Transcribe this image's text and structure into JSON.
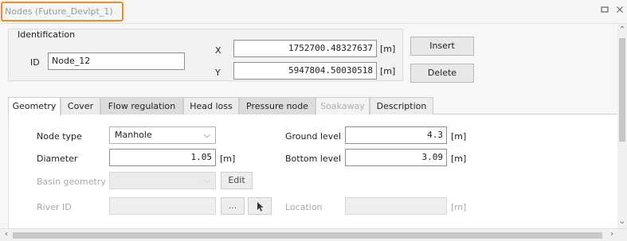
{
  "window": {
    "title": "Nodes (Future_Devlpt_1)",
    "maximize_icon": "maximize-icon",
    "close_icon": "close-icon",
    "accent_color": "#f08a24"
  },
  "identification": {
    "title": "Identification",
    "id_label": "ID",
    "id_value": "Node_12",
    "x_label": "X",
    "x_value": "1752700.48327637",
    "x_unit": "[m]",
    "y_label": "Y",
    "y_value": "5947804.50030518",
    "y_unit": "[m]",
    "insert_label": "Insert",
    "delete_label": "Delete"
  },
  "tabs": [
    {
      "label": "Geometry",
      "state": "active"
    },
    {
      "label": "Cover",
      "state": "normal"
    },
    {
      "label": "Flow regulation",
      "state": "normal"
    },
    {
      "label": "Head loss",
      "state": "normal"
    },
    {
      "label": "Pressure node",
      "state": "normal"
    },
    {
      "label": "Soakaway",
      "state": "disabled"
    },
    {
      "label": "Description",
      "state": "normal"
    }
  ],
  "geometry": {
    "node_type_label": "Node type",
    "node_type_value": "Manhole",
    "diameter_label": "Diameter",
    "diameter_value": "1.05",
    "diameter_unit": "[m]",
    "basin_geometry_label": "Basin geometry",
    "basin_geometry_value": "",
    "edit_label": "Edit",
    "river_id_label": "River ID",
    "river_id_value": "",
    "browse_label": "...",
    "pick_icon": "cursor-arrow-icon",
    "ground_level_label": "Ground level",
    "ground_level_value": "4.3",
    "ground_level_unit": "[m]",
    "bottom_level_label": "Bottom level",
    "bottom_level_value": "3.09",
    "bottom_level_unit": "[m]",
    "location_label": "Location",
    "location_value": "",
    "location_unit": "[m]"
  }
}
